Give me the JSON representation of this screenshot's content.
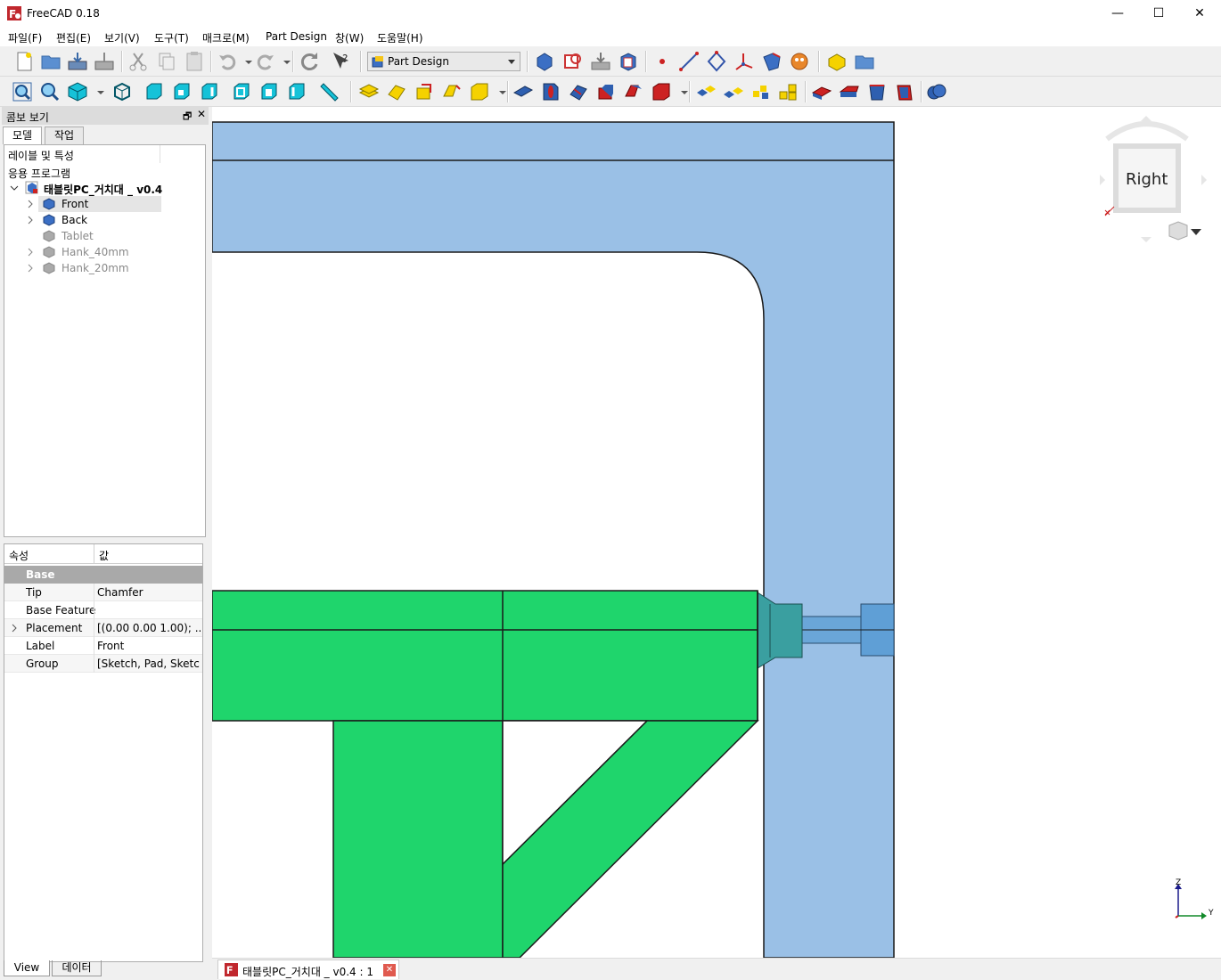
{
  "window": {
    "title": "FreeCAD 0.18",
    "minimize": "—",
    "maximize": "☐",
    "close": "✕"
  },
  "menu": [
    "파일(F)",
    "편집(E)",
    "보기(V)",
    "도구(T)",
    "매크로(M)",
    "Part Design",
    "창(W)",
    "도움말(H)"
  ],
  "toolbar": {
    "workbench": "Part Design"
  },
  "combo": {
    "title": "콤보 보기",
    "tabs": [
      "모델",
      "작업"
    ],
    "tree_header": "레이블 및 특성",
    "app_label": "응용 프로그램",
    "document": "태블릿PC_거치대 _ v0.4",
    "items": [
      {
        "label": "Front",
        "selected": true,
        "active": true
      },
      {
        "label": "Back",
        "selected": false,
        "active": true
      },
      {
        "label": "Tablet",
        "selected": false,
        "active": false
      },
      {
        "label": "Hank_40mm",
        "selected": false,
        "active": false
      },
      {
        "label": "Hank_20mm",
        "selected": false,
        "active": false
      }
    ]
  },
  "properties": {
    "col_prop": "속성",
    "col_value": "값",
    "group": "Base",
    "rows": [
      {
        "key": "Tip",
        "value": "Chamfer"
      },
      {
        "key": "Base Feature",
        "value": ""
      },
      {
        "key": "Placement",
        "value": "[(0.00 0.00 1.00); ..."
      },
      {
        "key": "Label",
        "value": "Front"
      },
      {
        "key": "Group",
        "value": "[Sketch, Pad, Sketc..."
      }
    ],
    "bottom_tabs": [
      "View",
      "데이터"
    ]
  },
  "viewport": {
    "navcube_face": "Right",
    "axis_z": "Z",
    "axis_y": "Y",
    "colors": {
      "green": "#1fd56c",
      "blue": "#9ac0e6",
      "teal": "#3a9fa0"
    }
  },
  "doc_tab": "태블릿PC_거치대 _ v0.4 : 1"
}
